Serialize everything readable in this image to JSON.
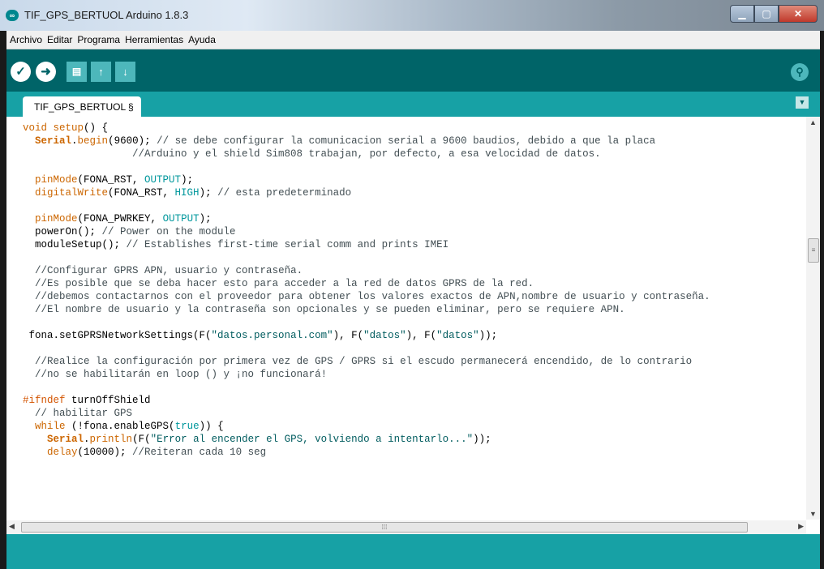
{
  "window": {
    "title": "TIF_GPS_BERTUOL Arduino 1.8.3"
  },
  "menu": [
    "Archivo",
    "Editar",
    "Programa",
    "Herramientas",
    "Ayuda"
  ],
  "tab": {
    "label": "TIF_GPS_BERTUOL §"
  },
  "colors": {
    "toolbar": "#006468",
    "tabbar": "#17a1a5",
    "keyword": "#cc6600",
    "literal": "#00979c",
    "comment": "#434f54"
  },
  "code": {
    "l1_void": "void",
    "l1_setup": "setup",
    "l1_rest": "() {",
    "l2_pre": "  ",
    "l2_serial": "Serial",
    "l2_dot": ".",
    "l2_begin": "begin",
    "l2_args": "(9600); ",
    "l2_cm": "// se debe configurar la comunicacion serial a 9600 baudios, debido a que la placa",
    "l3_cm": "                  //Arduino y el shield Sim808 trabajan, por defecto, a esa velocidad de datos.",
    "l5_fn": "pinMode",
    "l5_a": "(FONA_RST, ",
    "l5_lit": "OUTPUT",
    "l5_b": ");",
    "l6_fn": "digitalWrite",
    "l6_a": "(FONA_RST, ",
    "l6_lit": "HIGH",
    "l6_b": "); ",
    "l6_cm": "// esta predeterminado",
    "l8_fn": "pinMode",
    "l8_a": "(FONA_PWRKEY, ",
    "l8_lit": "OUTPUT",
    "l8_b": ");",
    "l9_a": "powerOn(); ",
    "l9_cm": "// Power on the module",
    "l10_a": "moduleSetup(); ",
    "l10_cm": "// Establishes first-time serial comm and prints IMEI",
    "l12_cm": "//Configurar GPRS APN, usuario y contraseña.",
    "l13_cm": "//Es posible que se deba hacer esto para acceder a la red de datos GPRS de la red.",
    "l14_cm": "//debemos contactarnos con el proveedor para obtener los valores exactos de APN,nombre de usuario y contraseña.",
    "l15_cm": "//El nombre de usuario y la contraseña son opcionales y se pueden eliminar, pero se requiere APN.",
    "l17_a": " fona.setGPRSNetworkSettings(F(",
    "l17_s1": "\"datos.personal.com\"",
    "l17_b": "), F(",
    "l17_s2": "\"datos\"",
    "l17_c": "), F(",
    "l17_s3": "\"datos\"",
    "l17_d": "));",
    "l19_cm": "//Realice la configuración por primera vez de GPS / GPRS si el escudo permanecerá encendido, de lo contrario",
    "l20_cm": "//no se habilitarán en loop () y ¡no funcionará!",
    "l22_kw": "#ifndef",
    "l22_a": " turnOffShield",
    "l23_cm": "// habilitar GPS",
    "l24_kw": "while",
    "l24_a": " (!fona.enableGPS(",
    "l24_lit": "true",
    "l24_b": ")) {",
    "l25_serial": "Serial",
    "l25_fn": "println",
    "l25_a": "(F(",
    "l25_s": "\"Error al encender el GPS, volviendo a intentarlo...\"",
    "l25_b": "));",
    "l26_fn": "delay",
    "l26_a": "(10000); ",
    "l26_cm": "//Reiteran cada 10 seg"
  }
}
